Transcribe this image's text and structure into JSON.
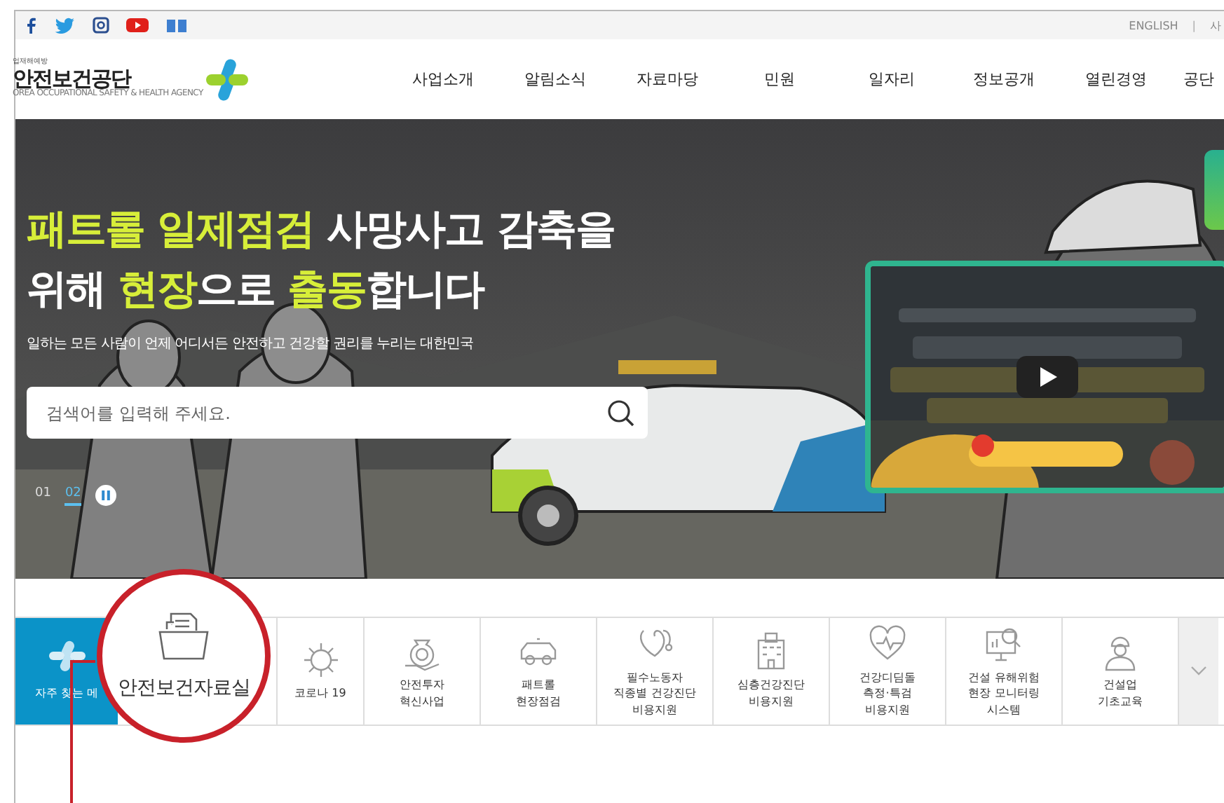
{
  "top_bar": {
    "links": [
      "ENGLISH",
      "사"
    ],
    "separator": "|"
  },
  "header": {
    "logo": {
      "tagline": "업재해예방",
      "name": "안전보건공단",
      "english": "OREA OCCUPATIONAL SAFETY & HEALTH AGENCY"
    },
    "nav": [
      "사업소개",
      "알림소식",
      "자료마당",
      "민원",
      "일자리",
      "정보공개",
      "열린경영",
      "공단"
    ]
  },
  "hero": {
    "headline": [
      [
        {
          "text": "패트롤 일제점검",
          "highlight": true
        },
        {
          "text": " 사망사고 감축을",
          "highlight": false
        }
      ],
      [
        {
          "text": "위해 ",
          "highlight": false
        },
        {
          "text": "현장",
          "highlight": true
        },
        {
          "text": "으로 ",
          "highlight": false
        },
        {
          "text": "출동",
          "highlight": true
        },
        {
          "text": "합니다",
          "highlight": false
        }
      ]
    ],
    "subtitle": "일하는 모든 사람이 언제 어디서든 안전하고 건강할 권리를 누리는 대한민국",
    "search": {
      "placeholder": "검색어를 입력해 주세요."
    },
    "slides": [
      {
        "label": "01",
        "selected": false
      },
      {
        "label": "02",
        "selected": true
      }
    ]
  },
  "quick_menu": {
    "title": "자주 찾는 메",
    "items": [
      {
        "lines": [
          "코로나 19"
        ]
      },
      {
        "lines": [
          "안전투자",
          "혁신사업"
        ]
      },
      {
        "lines": [
          "패트롤",
          "현장점검"
        ]
      },
      {
        "lines": [
          "필수노동자",
          "직종별 건강진단",
          "비용지원"
        ]
      },
      {
        "lines": [
          "심층건강진단",
          "비용지원"
        ]
      },
      {
        "lines": [
          "건강디딤돌",
          "측정·특검",
          "비용지원"
        ]
      },
      {
        "lines": [
          "건설 유해위험",
          "현장 모니터링",
          "시스템"
        ]
      },
      {
        "lines": [
          "건설업",
          "기초교육"
        ]
      }
    ]
  },
  "callout": {
    "label": "안전보건자료실"
  }
}
